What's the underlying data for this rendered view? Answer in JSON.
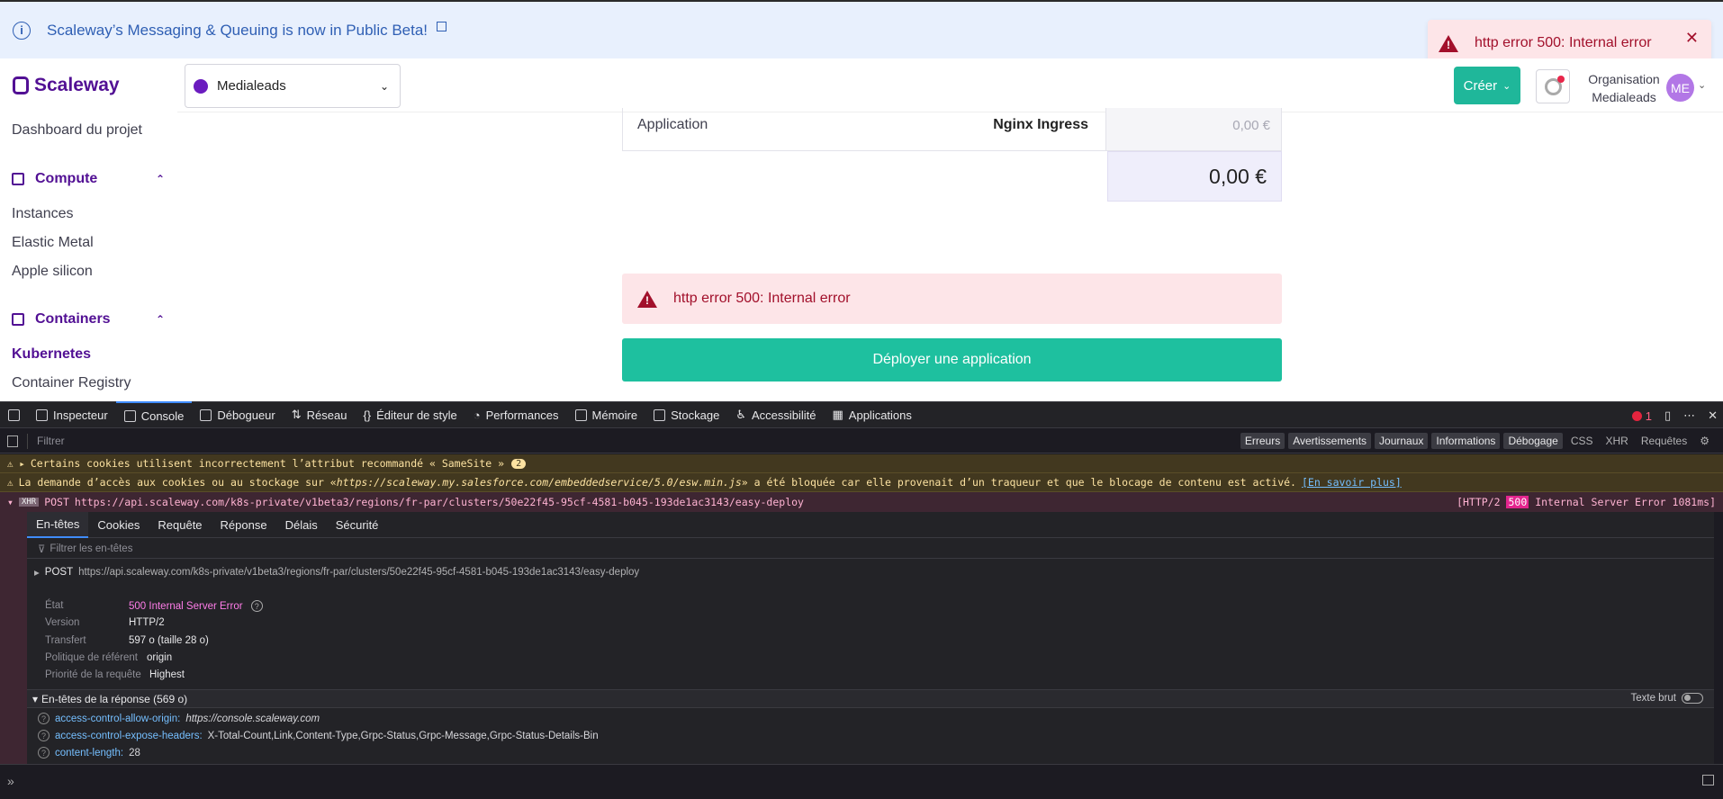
{
  "banner": {
    "text": "Scaleway’s Messaging & Queuing is now in Public Beta!"
  },
  "toast": {
    "text": "http error 500: Internal error",
    "close": "✕"
  },
  "brand": {
    "name": "Scaleway"
  },
  "sidebar": {
    "dashboard": "Dashboard du projet",
    "sections": [
      {
        "label": "Compute",
        "items": [
          "Instances",
          "Elastic Metal",
          "Apple silicon"
        ]
      },
      {
        "label": "Containers",
        "items": [
          "Kubernetes",
          "Container Registry"
        ]
      }
    ]
  },
  "project": {
    "name": "Medialeads"
  },
  "header": {
    "create_label": "Créer",
    "org_label": "Organisation",
    "org_name": "Medialeads",
    "avatar_initials": "ME"
  },
  "pricing": {
    "row_label": "Application",
    "row_value": "Nginx Ingress",
    "row_price": "0,00 €",
    "total": "0,00 €"
  },
  "alert": {
    "text": "http error 500: Internal error"
  },
  "deploy_button": "Déployer une application",
  "devtools": {
    "tabs": [
      "Inspecteur",
      "Console",
      "Débogueur",
      "Réseau",
      "Éditeur de style",
      "Performances",
      "Mémoire",
      "Stockage",
      "Accessibilité",
      "Applications"
    ],
    "selected_tab": "Console",
    "error_count": "1",
    "filter_placeholder": "Filtrer",
    "filter_buttons": [
      "Erreurs",
      "Avertissements",
      "Journaux",
      "Informations",
      "Débogage"
    ],
    "filter_plain": [
      "CSS",
      "XHR",
      "Requêtes"
    ],
    "warning1": "Certains cookies utilisent incorrectement l’attribut recommandé « SameSite »",
    "warning1_count": "2",
    "warning2_pre": "La demande d’accès aux cookies ou au stockage sur « ",
    "warning2_url": "https://scaleway.my.salesforce.com/embeddedservice/5.0/esw.min.js",
    "warning2_post": " » a été bloquée car elle provenait d’un traqueur et que le blocage de contenu est activé.",
    "warning2_link": "[En savoir plus]",
    "xhr_method": "POST",
    "xhr_badge": "XHR",
    "xhr_url": "https://api.scaleway.com/k8s-private/v1beta3/regions/fr-par/clusters/50e22f45-95cf-4581-b045-193de1ac3143/easy-deploy",
    "xhr_status_pre": "[HTTP/2",
    "xhr_status_code": "500",
    "xhr_status_post": "Internal Server Error 1081ms]",
    "panel_tabs": [
      "En-têtes",
      "Cookies",
      "Requête",
      "Réponse",
      "Délais",
      "Sécurité"
    ],
    "header_filter_placeholder": "Filtrer les en-têtes",
    "post_url": "https://api.scaleway.com/k8s-private/v1beta3/regions/fr-par/clusters/50e22f45-95cf-4581-b045-193de1ac3143/easy-deploy",
    "details": [
      {
        "key": "État",
        "value": "500 Internal Server Error"
      },
      {
        "key": "Version",
        "value": "HTTP/2"
      },
      {
        "key": "Transfert",
        "value": "597 o (taille 28 o)"
      },
      {
        "key": "Politique de référent",
        "value": "origin"
      },
      {
        "key": "Priorité de la requête",
        "value": "Highest"
      }
    ],
    "response_headers_label": "En-têtes de la réponse (569 o)",
    "raw_text_label": "Texte brut",
    "response_headers": [
      {
        "name": "access-control-allow-origin:",
        "value": "https://console.scaleway.com"
      },
      {
        "name": "access-control-expose-headers:",
        "value": "X-Total-Count,Link,Content-Type,Grpc-Status,Grpc-Message,Grpc-Status-Details-Bin"
      },
      {
        "name": "content-length:",
        "value": "28"
      }
    ]
  },
  "colors": {
    "brand": "#521094",
    "accent": "#1fb79a",
    "error": "#a2102b"
  }
}
